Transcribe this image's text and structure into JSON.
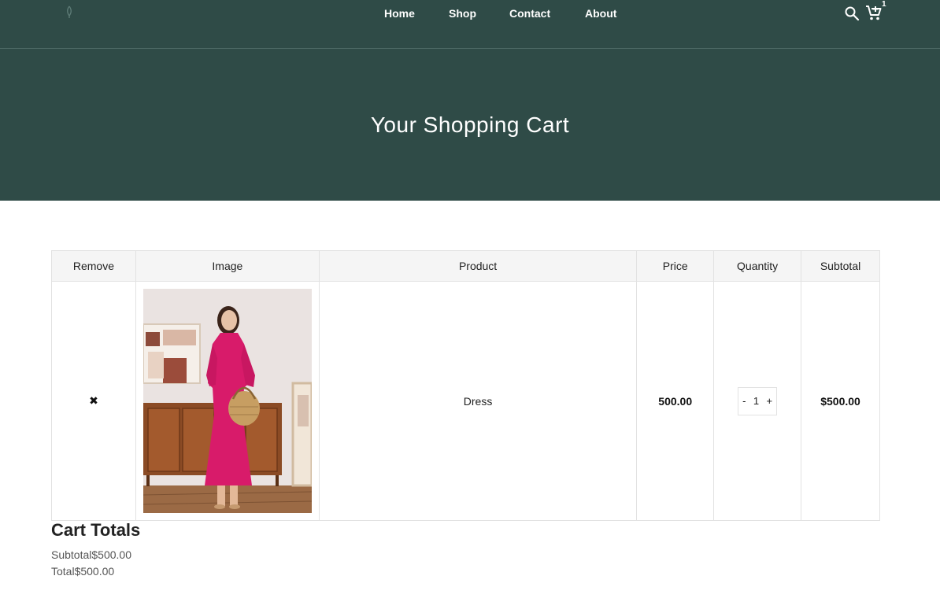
{
  "nav": {
    "home": "Home",
    "shop": "Shop",
    "contact": "Contact",
    "about": "About"
  },
  "header": {
    "cart_count": "1",
    "icons": [
      "logo-icon",
      "search-icon",
      "cart-icon"
    ]
  },
  "hero": {
    "title": "Your Shopping Cart"
  },
  "table": {
    "headers": [
      "Remove",
      "Image",
      "Product",
      "Price",
      "Quantity",
      "Subtotal"
    ],
    "rows": [
      {
        "remove": "✖",
        "product": "Dress",
        "price": "500.00",
        "qty_minus": "-",
        "quantity": "1",
        "qty_plus": "+",
        "subtotal": "$500.00"
      }
    ]
  },
  "totals": {
    "title": "Cart Totals",
    "subtotal_label": "Subtotal",
    "subtotal_value": "$500.00",
    "total_label": "Total",
    "total_value": "$500.00"
  },
  "colors": {
    "header_bg": "#2f4b47",
    "dress": "#d81b6a"
  }
}
